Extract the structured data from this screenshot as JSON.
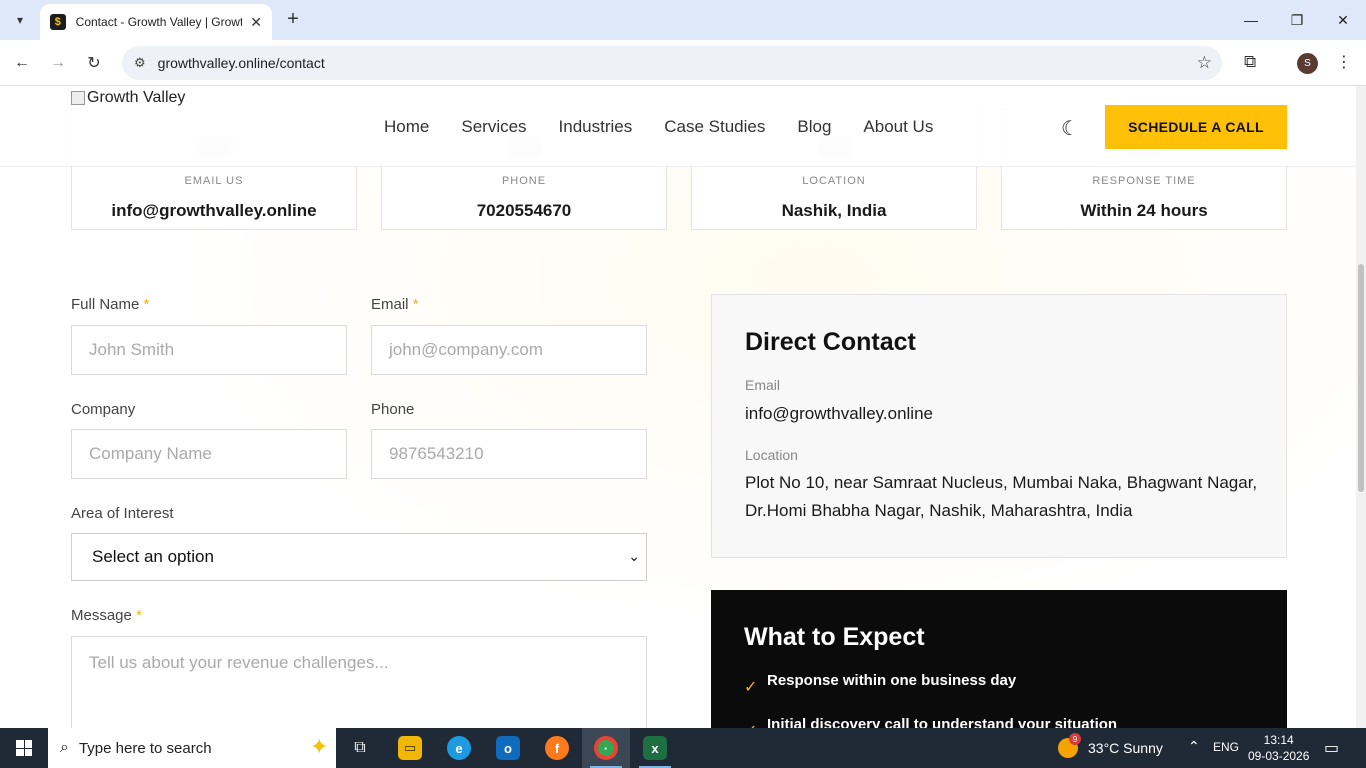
{
  "browser": {
    "tab_title": "Contact - Growth Valley | Growt",
    "url": "growthvalley.online/contact"
  },
  "site": {
    "logo_alt": "Growth Valley",
    "nav": [
      "Home",
      "Services",
      "Industries",
      "Case Studies",
      "Blog",
      "About Us"
    ],
    "cta": "SCHEDULE A CALL",
    "accent_color": "#ffc107"
  },
  "cards": [
    {
      "label": "EMAIL US",
      "value": "info@growthvalley.online"
    },
    {
      "label": "PHONE",
      "value": "7020554670"
    },
    {
      "label": "LOCATION",
      "value": "Nashik, India"
    },
    {
      "label": "RESPONSE TIME",
      "value": "Within 24 hours"
    }
  ],
  "form": {
    "full_name": {
      "label": "Full Name",
      "required": "*",
      "placeholder": "John Smith"
    },
    "email": {
      "label": "Email",
      "required": "*",
      "placeholder": "john@company.com"
    },
    "company": {
      "label": "Company",
      "placeholder": "Company Name"
    },
    "phone": {
      "label": "Phone",
      "placeholder": "9876543210"
    },
    "interest": {
      "label": "Area of Interest",
      "selected": "Select an option"
    },
    "message": {
      "label": "Message",
      "required": "*",
      "placeholder": "Tell us about your revenue challenges..."
    }
  },
  "direct_contact": {
    "title": "Direct Contact",
    "email_label": "Email",
    "email_value": "info@growthvalley.online",
    "location_label": "Location",
    "location_value": "Plot No 10, near Samraat Nucleus, Mumbai Naka, Bhagwant Nagar, Dr.Homi Bhabha Nagar, Nashik, Maharashtra, India"
  },
  "expect": {
    "title": "What to Expect",
    "items": [
      "Response within one business day",
      "Initial discovery call to understand your situation"
    ]
  },
  "taskbar": {
    "search_placeholder": "Type here to search",
    "weather": "33°C  Sunny",
    "weather_badge": "9",
    "lang": "ENG",
    "time": "13:14",
    "date": "09-03-2026"
  }
}
